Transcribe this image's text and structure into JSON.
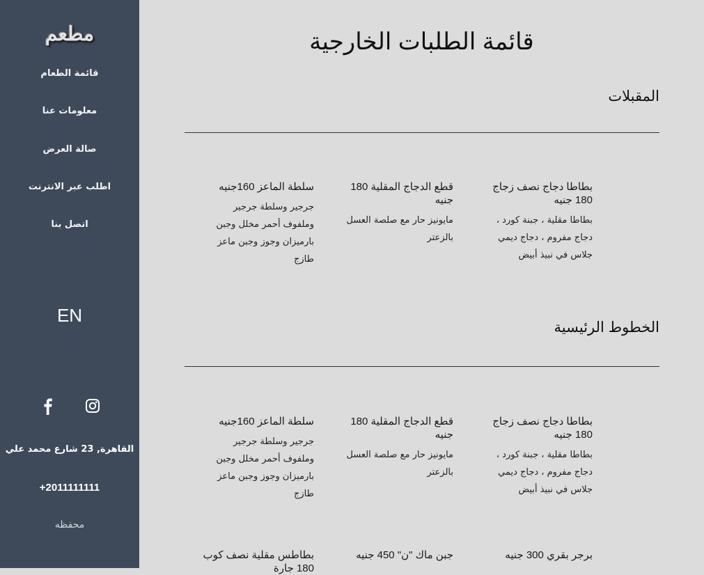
{
  "sidebar": {
    "logo": "مطعم",
    "nav": [
      "قائمة الطعام",
      "معلومات عنا",
      "صالة العرض",
      "اطلب عبر الانترنت",
      "اتصل بنا"
    ],
    "language": "EN",
    "social": [
      "instagram-icon",
      "facebook-icon"
    ],
    "address": "القاهرة, 23 شارع محمد علي",
    "phone": "+2011111111",
    "save": "محفظه"
  },
  "main": {
    "title": "قائمة الطلبات الخارجية",
    "sections": [
      {
        "title": "المقبلات",
        "items": [
          {
            "name": "بطاطا دجاج نصف زجاج 180 جنيه",
            "desc": "بطاطا مقلية ، جبنة كورد ، دجاج مفروم ، دجاج ديمي جلاس في نبيذ أبيض"
          },
          {
            "name": "قطع الدجاج المقلية 180 جنيه",
            "desc": "مايونيز حار مع صلصة العسل بالزعتر"
          },
          {
            "name": "سلطة الماعز 160جنيه",
            "desc": "جرجير وسلطة جرجير وملفوف أحمر مخلل وجبن بارميزان وجوز وجبن ماعز طازج"
          }
        ]
      },
      {
        "title": "الخطوط الرئيسية",
        "items": [
          {
            "name": "بطاطا دجاج نصف زجاج 180 جنيه",
            "desc": "بطاطا مقلية ، جبنة كورد ، دجاج مفروم ، دجاج ديمي جلاس في نبيذ أبيض"
          },
          {
            "name": "قطع الدجاج المقلية 180 جنيه",
            "desc": "مايونيز حار مع صلصة العسل بالزعتر"
          },
          {
            "name": "سلطة الماعز 160جنيه",
            "desc": "جرجير وسلطة جرجير وملفوف أحمر مخلل وجبن بارميزان وجوز وجبن ماعز طازج"
          }
        ],
        "items_more": [
          {
            "name": "برجر بقري 300 جنيه"
          },
          {
            "name": "جبن ماك \"ن\" 450 جنيه"
          },
          {
            "name": "بطاطس مقلية نصف كوب 180 جارة"
          }
        ]
      }
    ]
  }
}
